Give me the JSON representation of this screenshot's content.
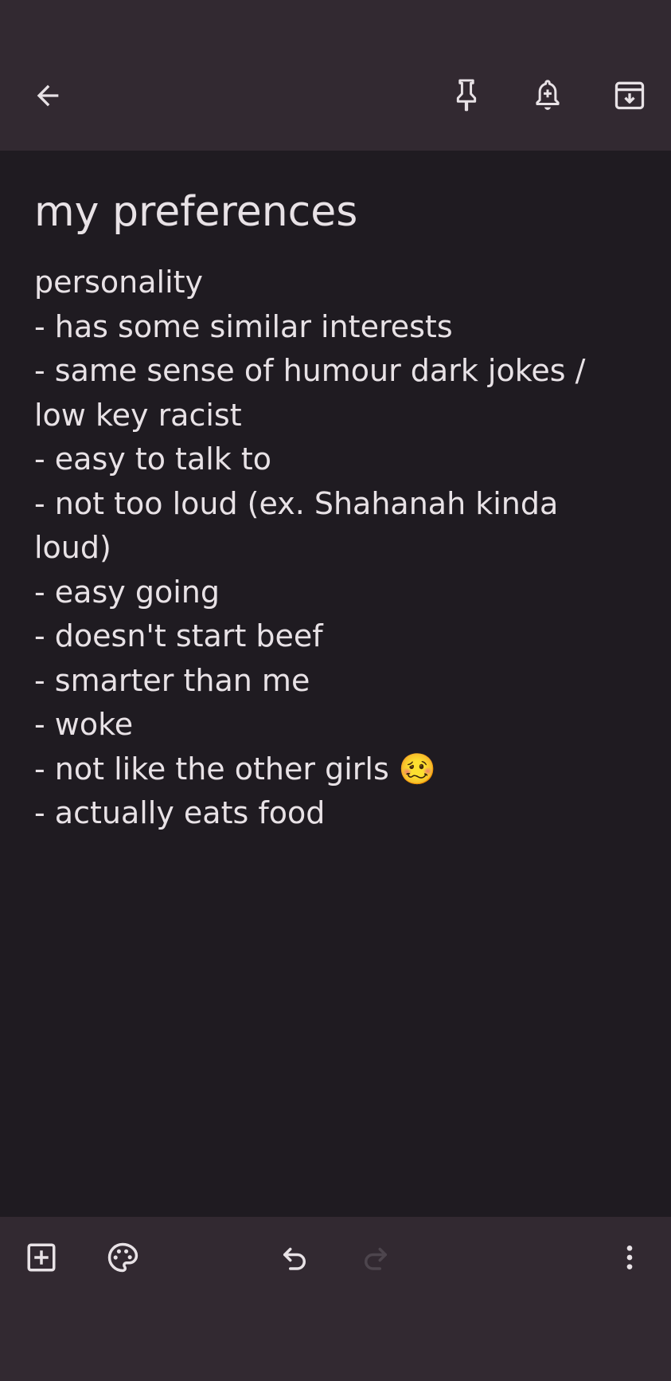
{
  "toolbar": {
    "icons": {
      "back": "arrow-back-icon",
      "pin": "pin-icon",
      "reminder": "add-reminder-bell-icon",
      "archive": "archive-icon"
    }
  },
  "note": {
    "title": "my preferences",
    "lines": [
      "personality",
      "- has some similar interests",
      "- same sense of humour dark jokes / low key racist",
      "- easy to talk to",
      "- not too loud (ex. Shahanah kinda loud)",
      "- easy going",
      "- doesn't start beef",
      "- smarter than me",
      "- woke",
      "- not like the other girls 🥴",
      "- actually eats food"
    ]
  },
  "bottom_toolbar": {
    "icons": {
      "add": "add-box-icon",
      "palette": "palette-icon",
      "undo": "undo-icon",
      "redo": "redo-icon",
      "more": "more-vert-icon"
    },
    "redo_enabled": false
  },
  "colors": {
    "bar_background": "#322931",
    "note_background": "#1f1b21",
    "text": "#e8e2e6",
    "icon": "#e8e2e6",
    "icon_disabled": "#4d454d"
  }
}
